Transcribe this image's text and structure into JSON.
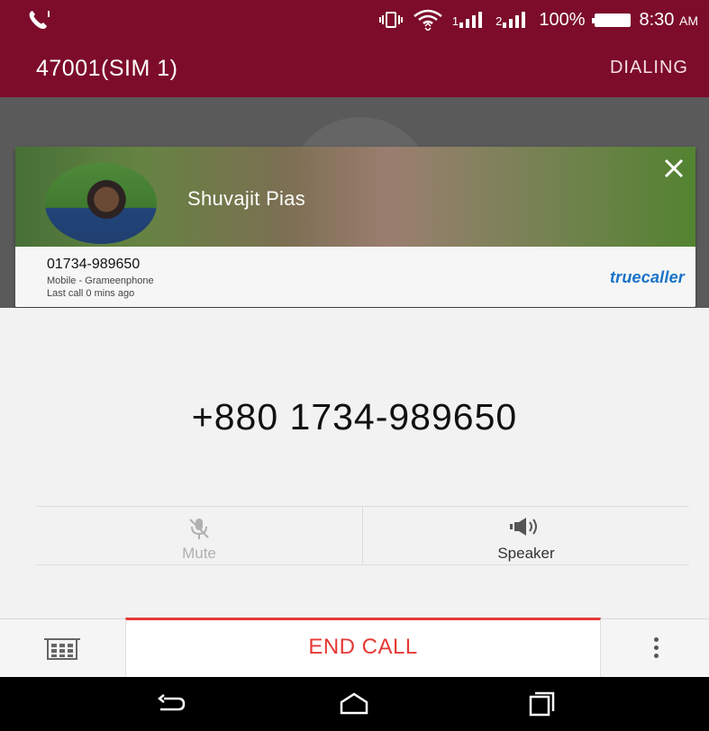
{
  "status_bar": {
    "battery": "100%",
    "time": "8:30",
    "ampm": "AM",
    "sim1": "1",
    "sim2": "2"
  },
  "title_bar": {
    "sim_label": "47001(SIM 1)",
    "call_state": "DIALING"
  },
  "truecaller": {
    "name": "Shuvajit Pias",
    "number": "01734-989650",
    "carrier": "Mobile - Grameenphone",
    "last_call": "Last call 0 mins ago",
    "brand": "truecaller",
    "brand_color": "#1a73c9"
  },
  "call": {
    "dialed_number": "+880 1734-989650",
    "actions": [
      {
        "label": "Mute",
        "icon": "mic-off-icon",
        "enabled": false
      },
      {
        "label": "Speaker",
        "icon": "speaker-icon",
        "enabled": true
      }
    ],
    "end_call_label": "END CALL",
    "end_call_color": "#e53935"
  },
  "colors": {
    "header": "#7c0c2a",
    "background": "#f2f2f2"
  },
  "nav_icons": [
    "back-icon",
    "home-icon",
    "recents-icon"
  ]
}
